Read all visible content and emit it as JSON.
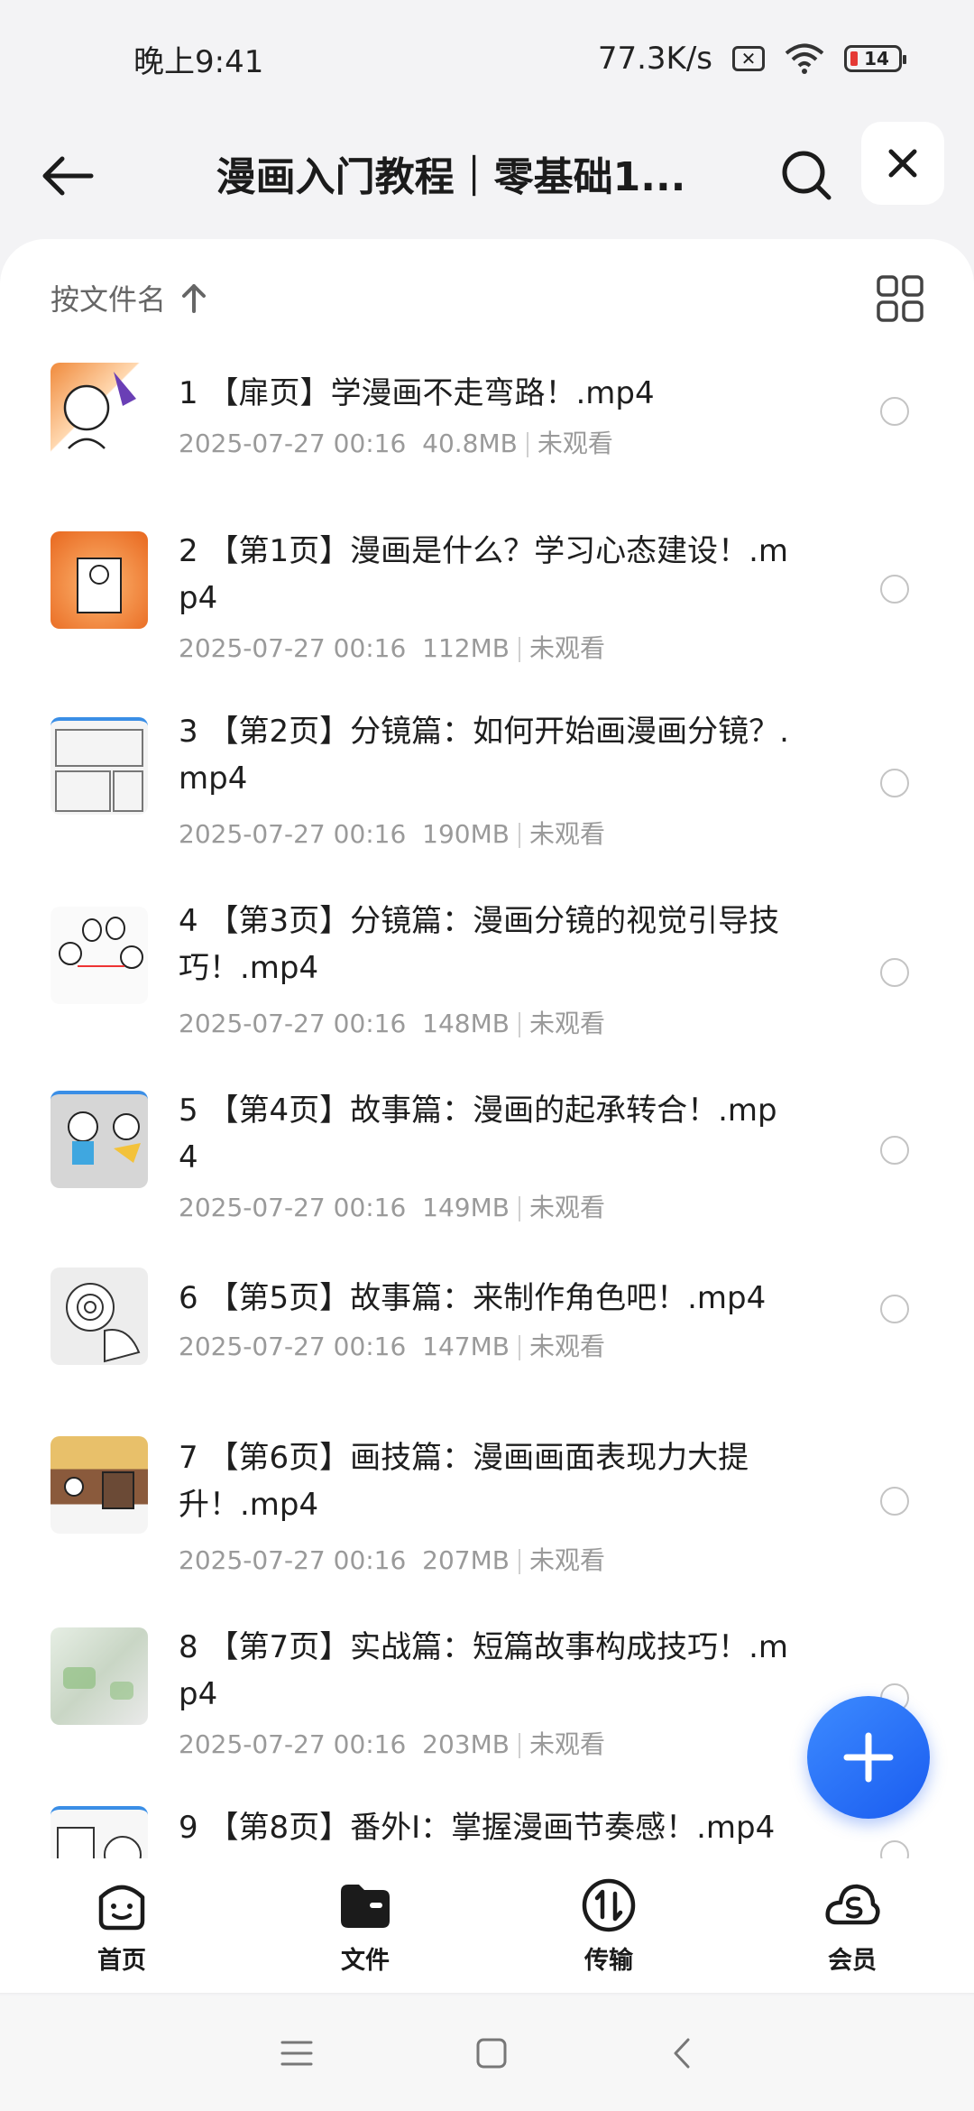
{
  "status_bar": {
    "time": "晚上9:41",
    "net_speed": "77.3K/s",
    "battery": "14"
  },
  "header": {
    "title": "漫画入门教程｜零基础1..."
  },
  "sort": {
    "label": "按文件名"
  },
  "files": [
    {
      "name": "1 【扉页】学漫画不走弯路！.mp4",
      "date": "2025-07-27 00:16",
      "size": "40.8MB",
      "status": "未观看"
    },
    {
      "name": "2 【第1页】漫画是什么？学习心态建设！.mp4",
      "date": "2025-07-27 00:16",
      "size": "112MB",
      "status": "未观看"
    },
    {
      "name": "3 【第2页】分镜篇：如何开始画漫画分镜？.mp4",
      "date": "2025-07-27 00:16",
      "size": "190MB",
      "status": "未观看"
    },
    {
      "name": "4 【第3页】分镜篇：漫画分镜的视觉引导技巧！.mp4",
      "date": "2025-07-27 00:16",
      "size": "148MB",
      "status": "未观看"
    },
    {
      "name": "5 【第4页】故事篇：漫画的起承转合！.mp4",
      "date": "2025-07-27 00:16",
      "size": "149MB",
      "status": "未观看"
    },
    {
      "name": "6 【第5页】故事篇：来制作角色吧！.mp4",
      "date": "2025-07-27 00:16",
      "size": "147MB",
      "status": "未观看"
    },
    {
      "name": "7 【第6页】画技篇：漫画画面表现力大提升！.mp4",
      "date": "2025-07-27 00:16",
      "size": "207MB",
      "status": "未观看"
    },
    {
      "name": "8 【第7页】实战篇：短篇故事构成技巧！.mp4",
      "date": "2025-07-27 00:16",
      "size": "203MB",
      "status": "未观看"
    },
    {
      "name": "9 【第8页】番外I：掌握漫画节奏感！.mp4",
      "date": "",
      "size": "",
      "status": ""
    }
  ],
  "bottom_nav": {
    "home": "首页",
    "files": "文件",
    "transfer": "传输",
    "vip": "会员"
  },
  "colors": {
    "accent": "#1a5cf0",
    "background": "#f3f3f5"
  }
}
